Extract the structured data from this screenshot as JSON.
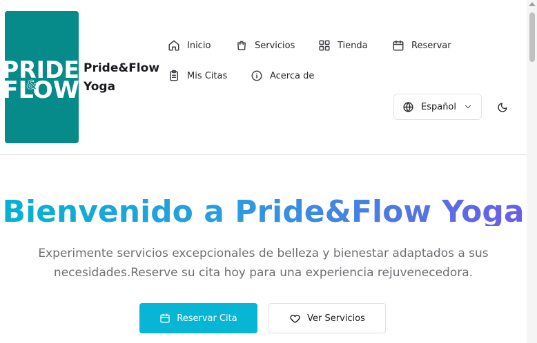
{
  "brand": {
    "logo_text_top": "PRIDE",
    "logo_text_amp": "&",
    "logo_text_bottom": "FLOW",
    "name": "Pride&Flow Yoga",
    "logo_color": "#078a8a"
  },
  "nav": {
    "items": [
      {
        "label": "Inicio",
        "icon": "home-icon"
      },
      {
        "label": "Servicios",
        "icon": "shopping-bag-icon"
      },
      {
        "label": "Tienda",
        "icon": "grid-icon"
      },
      {
        "label": "Reservar",
        "icon": "calendar-icon"
      },
      {
        "label": "Mis Citas",
        "icon": "clipboard-icon"
      },
      {
        "label": "Acerca de",
        "icon": "info-icon"
      }
    ]
  },
  "language": {
    "selected": "Español",
    "icon": "globe-icon"
  },
  "theme_toggle": {
    "icon": "moon-icon"
  },
  "hero": {
    "title": "Bienvenido a Pride&Flow Yoga",
    "subtitle": "Experimente servicios excepcionales de belleza y bienestar adaptados a sus necesidades.Reserve su cita hoy para una experiencia rejuvenecedora.",
    "primary_button": "Reservar Cita",
    "secondary_button": "Ver Servicios",
    "accent": "#06b6d4"
  }
}
